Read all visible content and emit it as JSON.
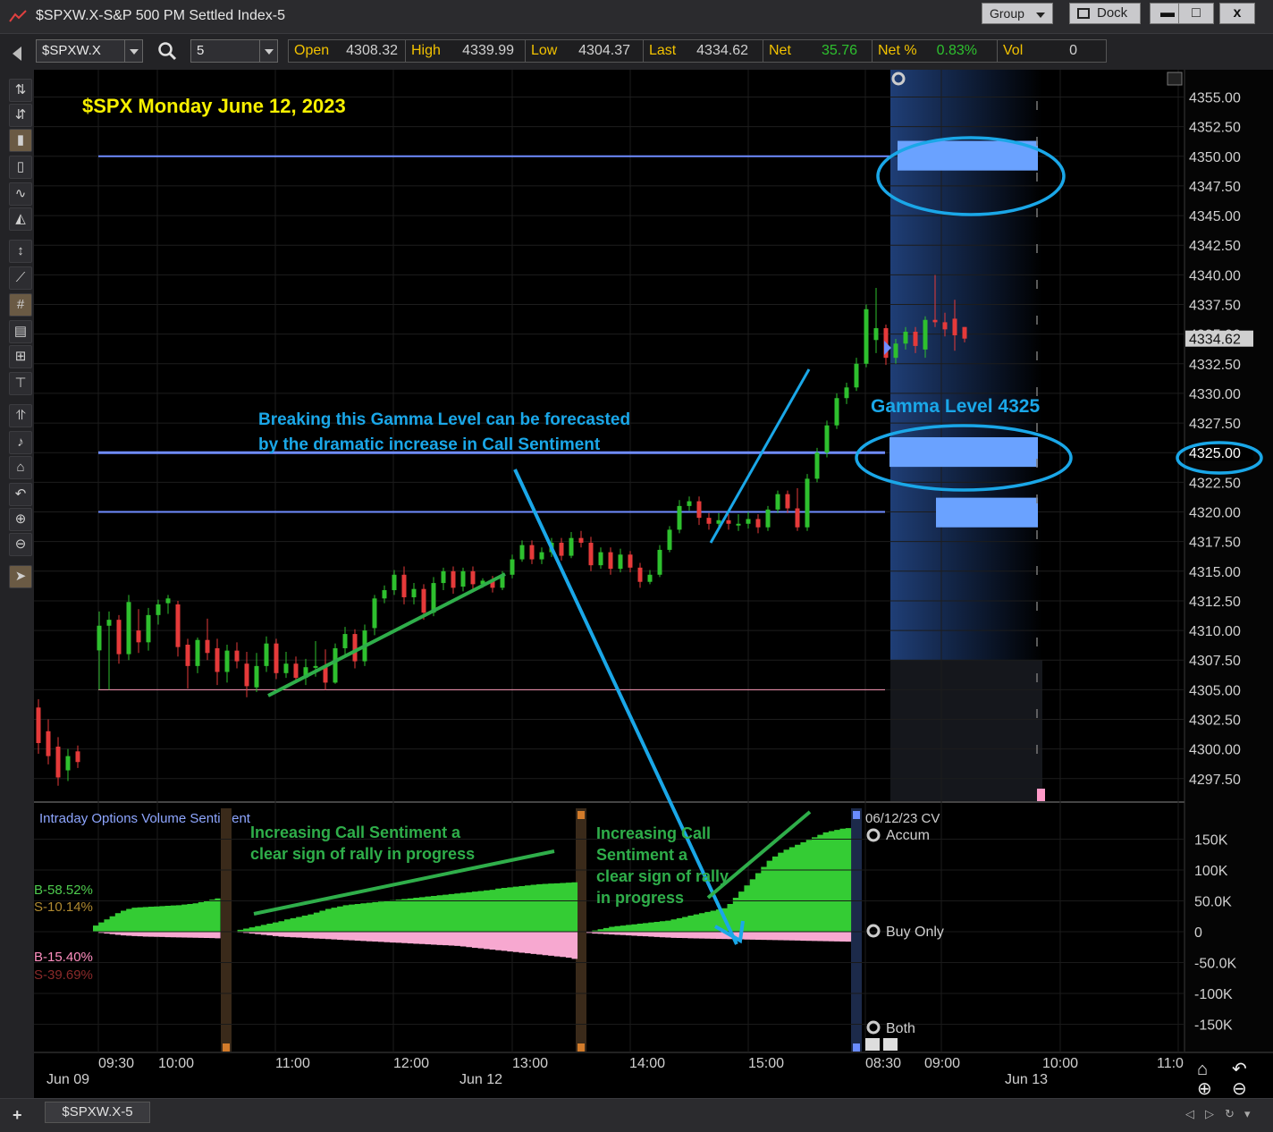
{
  "window": {
    "title": "$SPXW.X-S&P 500 PM Settled Index-5",
    "group_label": "Group",
    "dock_label": "Dock",
    "minimize": "▬",
    "maximize": "□",
    "close": "x"
  },
  "toolbar": {
    "symbol": "$SPXW.X",
    "interval": "5",
    "quote": {
      "open_label": "Open",
      "open": "4308.32",
      "high_label": "High",
      "high": "4339.99",
      "low_label": "Low",
      "low": "4304.37",
      "last_label": "Last",
      "last": "4334.62",
      "net_label": "Net",
      "net": "35.76",
      "netpct_label": "Net %",
      "netpct": "0.83%",
      "vol_label": "Vol",
      "vol": "0"
    }
  },
  "bottom": {
    "sheet_tab": "$SPXW.X-5",
    "add_tab": "+"
  },
  "colors": {
    "bull": "#2ec02e",
    "bear": "#e53a3a",
    "gamma": "#6f8cff",
    "gamma_block": "#6aa2ff",
    "annot_blue": "#1aa7e8",
    "annot_yellow": "#f7f000",
    "annot_green": "#2fae4a",
    "sentiment_buy": "#34cc34",
    "sentiment_sell": "#f7a8d0"
  },
  "chart_data": [
    {
      "type": "candlestick",
      "title": "$SPX Monday June 12, 2023",
      "y_ticks": [
        "4355.00",
        "4352.50",
        "4350.00",
        "4347.50",
        "4345.00",
        "4342.50",
        "4340.00",
        "4337.50",
        "4335.00",
        "4332.50",
        "4330.00",
        "4327.50",
        "4325.00",
        "4322.50",
        "4320.00",
        "4317.50",
        "4315.00",
        "4312.50",
        "4310.00",
        "4307.50",
        "4305.00",
        "4302.50",
        "4300.00",
        "4297.50"
      ],
      "ylim": [
        4295.6,
        4357.3
      ],
      "last_price_label": "4334.62",
      "highlight_price_label": "4325.00",
      "gamma_levels": [
        4350.0,
        4325.0,
        4320.0
      ],
      "support_level": 4305.0,
      "annotations": {
        "gamma_label": "Gamma Level 4325",
        "note_line1": "Breaking this Gamma Level can be forecasted",
        "note_line2": "by the dramatic increase in Call Sentiment"
      },
      "candles_jun09": [
        [
          4303.5,
          4300.5,
          4304.2,
          4299.6
        ],
        [
          4301.5,
          4299.4,
          4302.5,
          4298.7
        ],
        [
          4300.2,
          4297.6,
          4301.0,
          4296.9
        ],
        [
          4298.2,
          4299.4,
          4300.0,
          4297.3
        ],
        [
          4299.8,
          4298.9,
          4300.3,
          4298.4
        ]
      ],
      "candles_jun12": [
        [
          4308.32,
          4310.4,
          4311.6,
          4305.0
        ],
        [
          4310.4,
          4310.9,
          4311.6,
          4305.0
        ],
        [
          4310.9,
          4308.0,
          4311.3,
          4307.2
        ],
        [
          4308.0,
          4312.4,
          4313.0,
          4307.5
        ],
        [
          4310.0,
          4309.0,
          4311.8,
          4308.1
        ],
        [
          4309.0,
          4311.3,
          4311.9,
          4308.3
        ],
        [
          4311.3,
          4312.2,
          4312.6,
          4310.5
        ],
        [
          4312.3,
          4312.7,
          4313.0,
          4311.4
        ],
        [
          4312.2,
          4308.6,
          4312.5,
          4307.8
        ],
        [
          4308.8,
          4307.0,
          4309.3,
          4305.1
        ],
        [
          4307.0,
          4309.2,
          4309.4,
          4306.4
        ],
        [
          4309.2,
          4308.1,
          4311.0,
          4307.5
        ],
        [
          4308.5,
          4306.5,
          4309.3,
          4305.4
        ],
        [
          4306.5,
          4308.3,
          4308.8,
          4305.6
        ],
        [
          4308.3,
          4307.4,
          4309.0,
          4306.8
        ],
        [
          4307.2,
          4305.3,
          4308.2,
          4304.37
        ],
        [
          4305.2,
          4307.0,
          4308.1,
          4304.8
        ],
        [
          4307.0,
          4308.9,
          4309.5,
          4306.5
        ],
        [
          4308.9,
          4306.4,
          4309.3,
          4305.9
        ],
        [
          4306.4,
          4307.2,
          4308.2,
          4306.0
        ],
        [
          4307.2,
          4306.0,
          4307.8,
          4305.6
        ],
        [
          4306.0,
          4306.9,
          4307.6,
          4305.4
        ],
        [
          4307.0,
          4307.0,
          4309.1,
          4306.1
        ],
        [
          4307.0,
          4305.6,
          4308.4,
          4305.0
        ],
        [
          4305.6,
          4308.5,
          4308.9,
          4305.5
        ],
        [
          4308.5,
          4309.7,
          4310.3,
          4307.8
        ],
        [
          4309.7,
          4307.4,
          4310.1,
          4306.8
        ],
        [
          4307.4,
          4310.0,
          4310.5,
          4307.0
        ],
        [
          4310.2,
          4312.7,
          4313.0,
          4309.6
        ],
        [
          4312.7,
          4313.4,
          4313.8,
          4312.3
        ],
        [
          4313.4,
          4314.7,
          4315.1,
          4313.0
        ],
        [
          4314.7,
          4312.8,
          4315.4,
          4312.2
        ],
        [
          4312.8,
          4313.5,
          4314.0,
          4312.2
        ],
        [
          4313.5,
          4311.5,
          4313.9,
          4310.9
        ],
        [
          4311.5,
          4314.0,
          4314.5,
          4311.2
        ],
        [
          4314.0,
          4315.0,
          4315.3,
          4313.4
        ],
        [
          4315.0,
          4313.6,
          4315.4,
          4313.1
        ],
        [
          4313.7,
          4315.0,
          4315.3,
          4313.3
        ],
        [
          4315.0,
          4313.9,
          4315.4,
          4313.5
        ],
        [
          4313.9,
          4314.2,
          4314.4,
          4313.6
        ],
        [
          4314.2,
          4313.6,
          4314.6,
          4313.2
        ],
        [
          4313.6,
          4314.7,
          4315.0,
          4313.4
        ],
        [
          4314.7,
          4316.0,
          4316.4,
          4314.4
        ],
        [
          4316.0,
          4317.2,
          4317.6,
          4315.8
        ],
        [
          4317.2,
          4316.0,
          4317.6,
          4315.6
        ],
        [
          4316.0,
          4316.6,
          4317.0,
          4315.6
        ],
        [
          4316.6,
          4317.4,
          4317.8,
          4316.2
        ],
        [
          4317.4,
          4316.3,
          4317.8,
          4315.9
        ],
        [
          4316.3,
          4317.8,
          4318.3,
          4316.1
        ],
        [
          4317.8,
          4317.4,
          4318.4,
          4317.0
        ],
        [
          4317.4,
          4315.5,
          4317.9,
          4315.0
        ],
        [
          4315.5,
          4316.6,
          4317.0,
          4315.2
        ],
        [
          4316.6,
          4315.2,
          4317.0,
          4314.7
        ],
        [
          4315.2,
          4316.4,
          4316.9,
          4314.9
        ],
        [
          4316.4,
          4315.3,
          4316.7,
          4314.9
        ],
        [
          4315.3,
          4314.1,
          4315.7,
          4313.6
        ],
        [
          4314.1,
          4314.7,
          4315.1,
          4313.9
        ],
        [
          4314.7,
          4316.8,
          4317.2,
          4314.5
        ],
        [
          4316.8,
          4318.5,
          4318.8,
          4316.6
        ],
        [
          4318.5,
          4320.5,
          4321.0,
          4318.2
        ],
        [
          4320.5,
          4320.9,
          4321.3,
          4320.1
        ],
        [
          4320.9,
          4319.5,
          4321.3,
          4318.9
        ],
        [
          4319.5,
          4319.0,
          4319.9,
          4318.5
        ],
        [
          4319.0,
          4319.3,
          4319.9,
          4318.7
        ],
        [
          4319.3,
          4319.0,
          4319.8,
          4318.5
        ],
        [
          4319.0,
          4319.0,
          4319.8,
          4318.4
        ],
        [
          4319.0,
          4319.4,
          4320.0,
          4318.6
        ],
        [
          4319.4,
          4318.7,
          4319.8,
          4318.2
        ],
        [
          4318.7,
          4320.2,
          4320.5,
          4318.4
        ],
        [
          4320.2,
          4321.5,
          4321.8,
          4319.9
        ],
        [
          4321.5,
          4320.3,
          4321.8,
          4319.9
        ],
        [
          4320.3,
          4318.7,
          4322.0,
          4318.4
        ],
        [
          4318.7,
          4322.8,
          4323.2,
          4318.4
        ],
        [
          4322.8,
          4325.0,
          4325.4,
          4322.5
        ],
        [
          4325.0,
          4327.3,
          4327.7,
          4324.6
        ],
        [
          4327.3,
          4329.6,
          4330.0,
          4327.0
        ],
        [
          4329.6,
          4330.5,
          4330.9,
          4329.1
        ],
        [
          4330.5,
          4332.5,
          4333.0,
          4330.2
        ],
        [
          4332.5,
          4337.1,
          4337.5,
          4332.2
        ],
        [
          4334.5,
          4335.5,
          4338.9,
          4333.4
        ],
        [
          4335.5,
          4333.0,
          4335.8,
          4332.4
        ],
        [
          4333.0,
          4334.2,
          4334.6,
          4332.5
        ],
        [
          4334.2,
          4335.2,
          4335.6,
          4333.7
        ],
        [
          4335.2,
          4334.0,
          4335.6,
          4333.4
        ],
        [
          4333.7,
          4336.2,
          4336.5,
          4333.0
        ],
        [
          4336.2,
          4336.0,
          4339.99,
          4335.6
        ],
        [
          4336.0,
          4335.4,
          4336.8,
          4334.8
        ],
        [
          4336.3,
          4334.9,
          4337.9,
          4333.6
        ],
        [
          4335.6,
          4334.62,
          4335.6,
          4334.3
        ]
      ],
      "x_ticks": [
        "09:30",
        "10:00",
        "11:00",
        "12:00",
        "13:00",
        "14:00",
        "15:00",
        "08:30",
        "09:00",
        "10:00",
        "11:0"
      ],
      "x_date_labels": [
        "Jun 09",
        "Jun 12",
        "Jun 13"
      ]
    },
    {
      "type": "area",
      "title": "Intraday Options Volume Sentiment",
      "y_ticks": [
        "150K",
        "100K",
        "50.0K",
        "0",
        "-50.0K",
        "-100K",
        "-150K"
      ],
      "ylim": [
        -170000,
        170000
      ],
      "stats": {
        "b_pos": "B-58.52%",
        "s_pos": "S-10.14%",
        "b_neg": "B-15.40%",
        "s_neg": "S-39.69%"
      },
      "corner_label": "06/12/23 CV",
      "series_labels": {
        "accum": "Accum",
        "buy_only": "Buy Only",
        "both": "Both"
      },
      "annotations": {
        "left_note_l1": "Increasing Call Sentiment a",
        "left_note_l2": "clear sign of rally in progress",
        "right_note_l1": "Increasing Call",
        "right_note_l2": "Sentiment a",
        "right_note_l3": "clear sign of rally",
        "right_note_l4": "in progress"
      },
      "buy_jun09": [
        10000,
        15000,
        20000,
        25000,
        30000,
        34000,
        37000,
        39000,
        39500,
        40000,
        40500,
        41000,
        41500,
        42000,
        42500,
        43000,
        44000,
        45000,
        46000,
        48000,
        50000,
        52000,
        54000
      ],
      "sell_jun09": [
        0,
        -2000,
        -3000,
        -4000,
        -5000,
        -6000,
        -6500,
        -7000,
        -7500,
        -8000,
        -8200,
        -8400,
        -8600,
        -8800,
        -9000,
        -9200,
        -9400,
        -9600,
        -9800,
        -10000,
        -10200,
        -10400,
        -10600
      ],
      "buy_seg2": [
        0,
        3000,
        5000,
        7000,
        9000,
        11000,
        13000,
        15000,
        17000,
        20000,
        22000,
        24000,
        26000,
        28000,
        31000,
        34000,
        37000,
        39000,
        41000,
        43000,
        44000,
        45000,
        46000,
        47000,
        48000,
        49000,
        50000,
        51000,
        52000,
        53000,
        54000,
        55000,
        56000,
        57000,
        58000,
        59000,
        60000,
        61000,
        62000,
        63000,
        64000,
        65000,
        66000,
        67000,
        68000,
        70000,
        71000,
        72000,
        73000,
        74000,
        75000,
        76000,
        77000,
        77500,
        78000,
        78500,
        79000,
        79500,
        80000
      ],
      "sell_seg2": [
        0,
        -1000,
        -2000,
        -3000,
        -4000,
        -5000,
        -6000,
        -7000,
        -8000,
        -8500,
        -9000,
        -9500,
        -10000,
        -10500,
        -11000,
        -11500,
        -12000,
        -12500,
        -13000,
        -13500,
        -14000,
        -14500,
        -15000,
        -15500,
        -16000,
        -16500,
        -17000,
        -17500,
        -18000,
        -18500,
        -19000,
        -19500,
        -20000,
        -20500,
        -21000,
        -21500,
        -22000,
        -22500,
        -23000,
        -24000,
        -25000,
        -26000,
        -27000,
        -28000,
        -29000,
        -30000,
        -31000,
        -32000,
        -33000,
        -34000,
        -35000,
        -36000,
        -37000,
        -38000,
        -39000,
        -40000,
        -41000,
        -42000,
        -44000
      ],
      "buy_seg3": [
        0,
        2000,
        4000,
        6000,
        8000,
        9000,
        10000,
        11000,
        12000,
        13000,
        14000,
        15000,
        16000,
        17000,
        18000,
        20000,
        22000,
        24000,
        26000,
        28000,
        30000,
        32000,
        34000,
        36000,
        38000,
        45000,
        55000,
        65000,
        75000,
        85000,
        95000,
        105000,
        115000,
        122000,
        128000,
        133000,
        137000,
        141000,
        145000,
        149000,
        153000,
        157000,
        161000,
        163000,
        165000,
        167000,
        168000
      ],
      "sell_seg3": [
        -2000,
        -3000,
        -3500,
        -4000,
        -4500,
        -5000,
        -5500,
        -6000,
        -6500,
        -7000,
        -7500,
        -8000,
        -8500,
        -9000,
        -9500,
        -10000,
        -10200,
        -10400,
        -10600,
        -10800,
        -11000,
        -11200,
        -11400,
        -11600,
        -11800,
        -12000,
        -12200,
        -12400,
        -12600,
        -12800,
        -13000,
        -13200,
        -13400,
        -13600,
        -13800,
        -14000,
        -14200,
        -14400,
        -14600,
        -14800,
        -15000,
        -15200,
        -15400,
        -15600,
        -15800,
        -16000,
        -16200
      ]
    }
  ]
}
